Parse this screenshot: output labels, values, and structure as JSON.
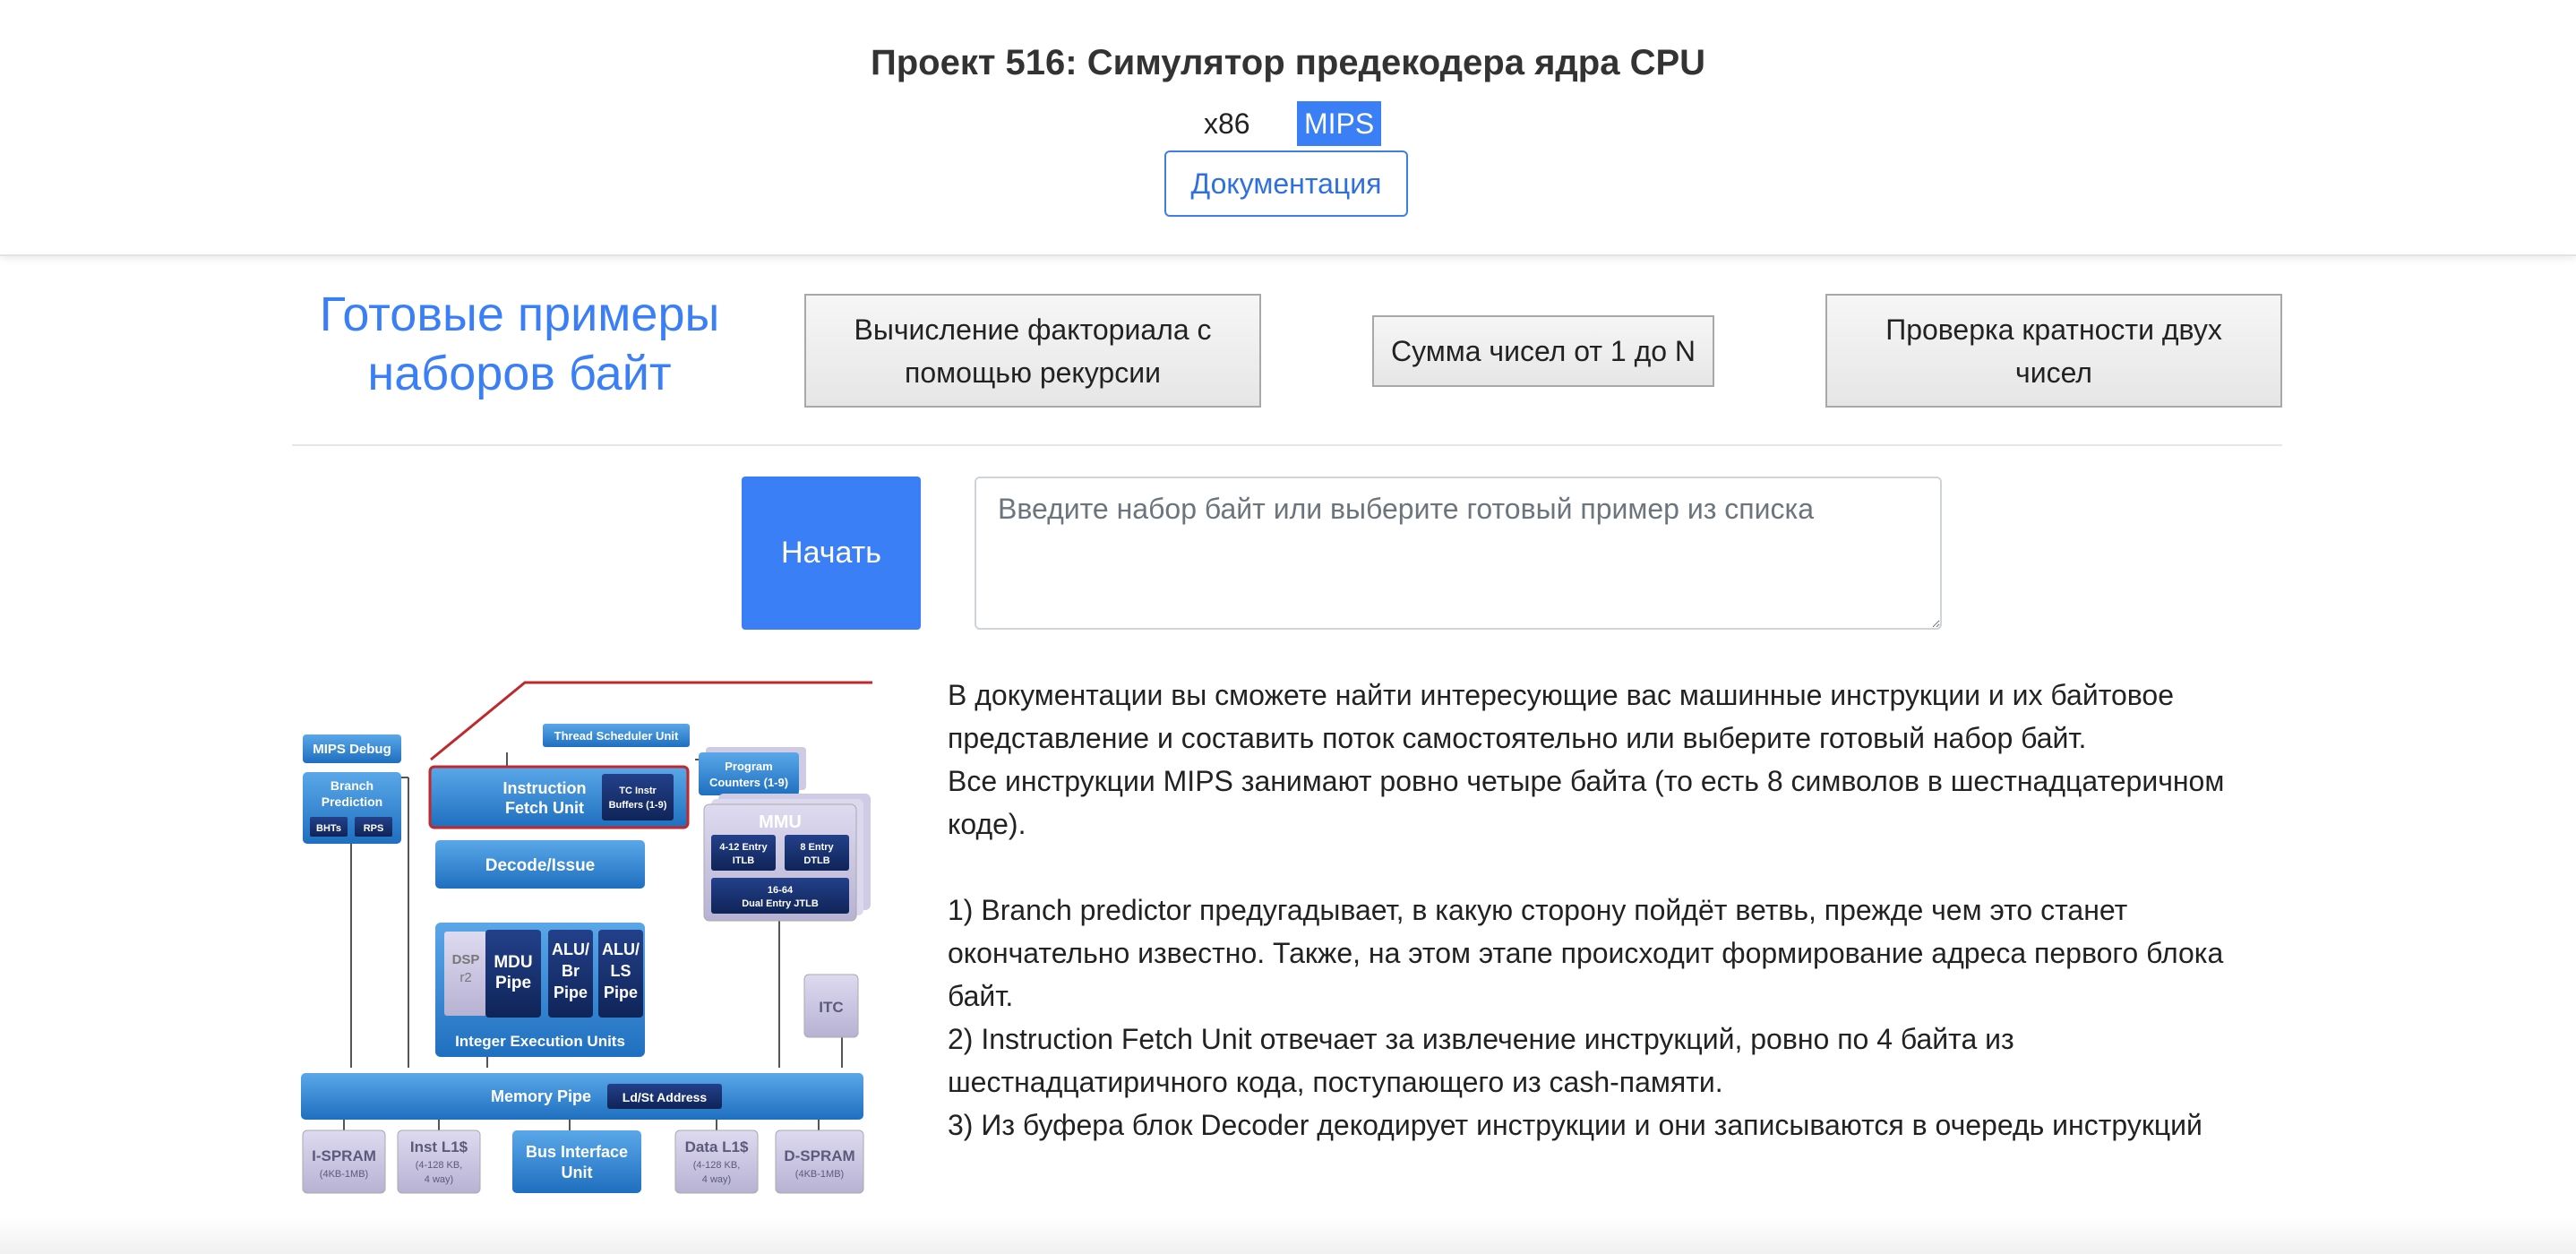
{
  "header": {
    "title": "Проект 516: Симулятор предекодера ядра CPU",
    "arch_tabs": [
      "x86",
      "MIPS"
    ],
    "active_arch": "MIPS",
    "docs_button": "Документация"
  },
  "examples": {
    "title_line1": "Готовые примеры",
    "title_line2": "наборов байт",
    "buttons": [
      {
        "line1": "Вычисление факториала с",
        "line2": "помощью рекурсии"
      },
      {
        "line1": "Сумма чисел от 1 до N",
        "line2": ""
      },
      {
        "line1": "Проверка кратности двух",
        "line2": "чисел"
      }
    ]
  },
  "input": {
    "start_button": "Начать",
    "placeholder": "Введите набор байт или выберите готовый пример из списка",
    "value": ""
  },
  "diagram": {
    "mips_debug": "MIPS Debug",
    "thread_scheduler": "Thread Scheduler Unit",
    "branch_prediction_1": "Branch",
    "branch_prediction_2": "Prediction",
    "bhts": "BHTs",
    "rps": "RPS",
    "ifu_1": "Instruction",
    "ifu_2": "Fetch Unit",
    "tc_1": "TC Instr",
    "tc_2": "Buffers (1-9)",
    "pc_1": "Program",
    "pc_2": "Counters (1-9)",
    "mmu": "MMU",
    "itlb_1": "4-12 Entry",
    "itlb_2": "ITLB",
    "dtlb_1": "8 Entry",
    "dtlb_2": "DTLB",
    "jtlb_1": "16-64",
    "jtlb_2": "Dual Entry JTLB",
    "decode": "Decode/Issue",
    "dsp_1": "DSP",
    "dsp_2": "r2",
    "mdu_1": "MDU",
    "mdu_2": "Pipe",
    "alubr_1": "ALU/",
    "alubr_2": "Br",
    "alubr_3": "Pipe",
    "alels_1": "ALU/",
    "alels_2": "LS",
    "alels_3": "Pipe",
    "ieu": "Integer Execution Units",
    "itc": "ITC",
    "memory_pipe": "Memory Pipe",
    "ldst": "Ld/St Address",
    "ispram_1": "I-SPRAM",
    "ispram_2": "(4KB-1MB)",
    "instl1_1": "Inst L1$",
    "instl1_2": "(4-128 KB,",
    "instl1_3": "4 way)",
    "biu_1": "Bus Interface",
    "biu_2": "Unit",
    "datal1_1": "Data L1$",
    "datal1_2": "(4-128 KB,",
    "datal1_3": "4 way)",
    "dspram_1": "D-SPRAM",
    "dspram_2": "(4KB-1MB)"
  },
  "description": {
    "line1": "В документации вы сможете найти интересующие вас машинные инструкции и их байтовое",
    "line2": "представление и составить поток самостоятельно или выберите готовый набор байт.",
    "line3": "Все инструкции MIPS занимают ровно четыре байта (то есть 8 символов в шестнадцатеричном",
    "line4": "коде).",
    "line5": "1) Branch predictor предугадывает, в какую сторону пойдёт ветвь, прежде чем это станет",
    "line6": "окончательно известно. Также, на этом этапе происходит формирование адреса первого блока",
    "line7": "байт.",
    "line8": "2) Instruction Fetch Unit отвечает за извлечение инструкций, ровно по 4 байта из",
    "line9": "шестнадцатиричного кода, поступающего из cash-памяти.",
    "line10": "3) Из буфера блок Decoder декодирует инструкции и они записываются в очередь инструкций"
  },
  "colors": {
    "accent": "#3a7ff6",
    "block_blue": "#2f7fd0",
    "block_dark": "#16306e",
    "block_gray": "#c9c5de",
    "highlight_red": "#c0282d"
  }
}
